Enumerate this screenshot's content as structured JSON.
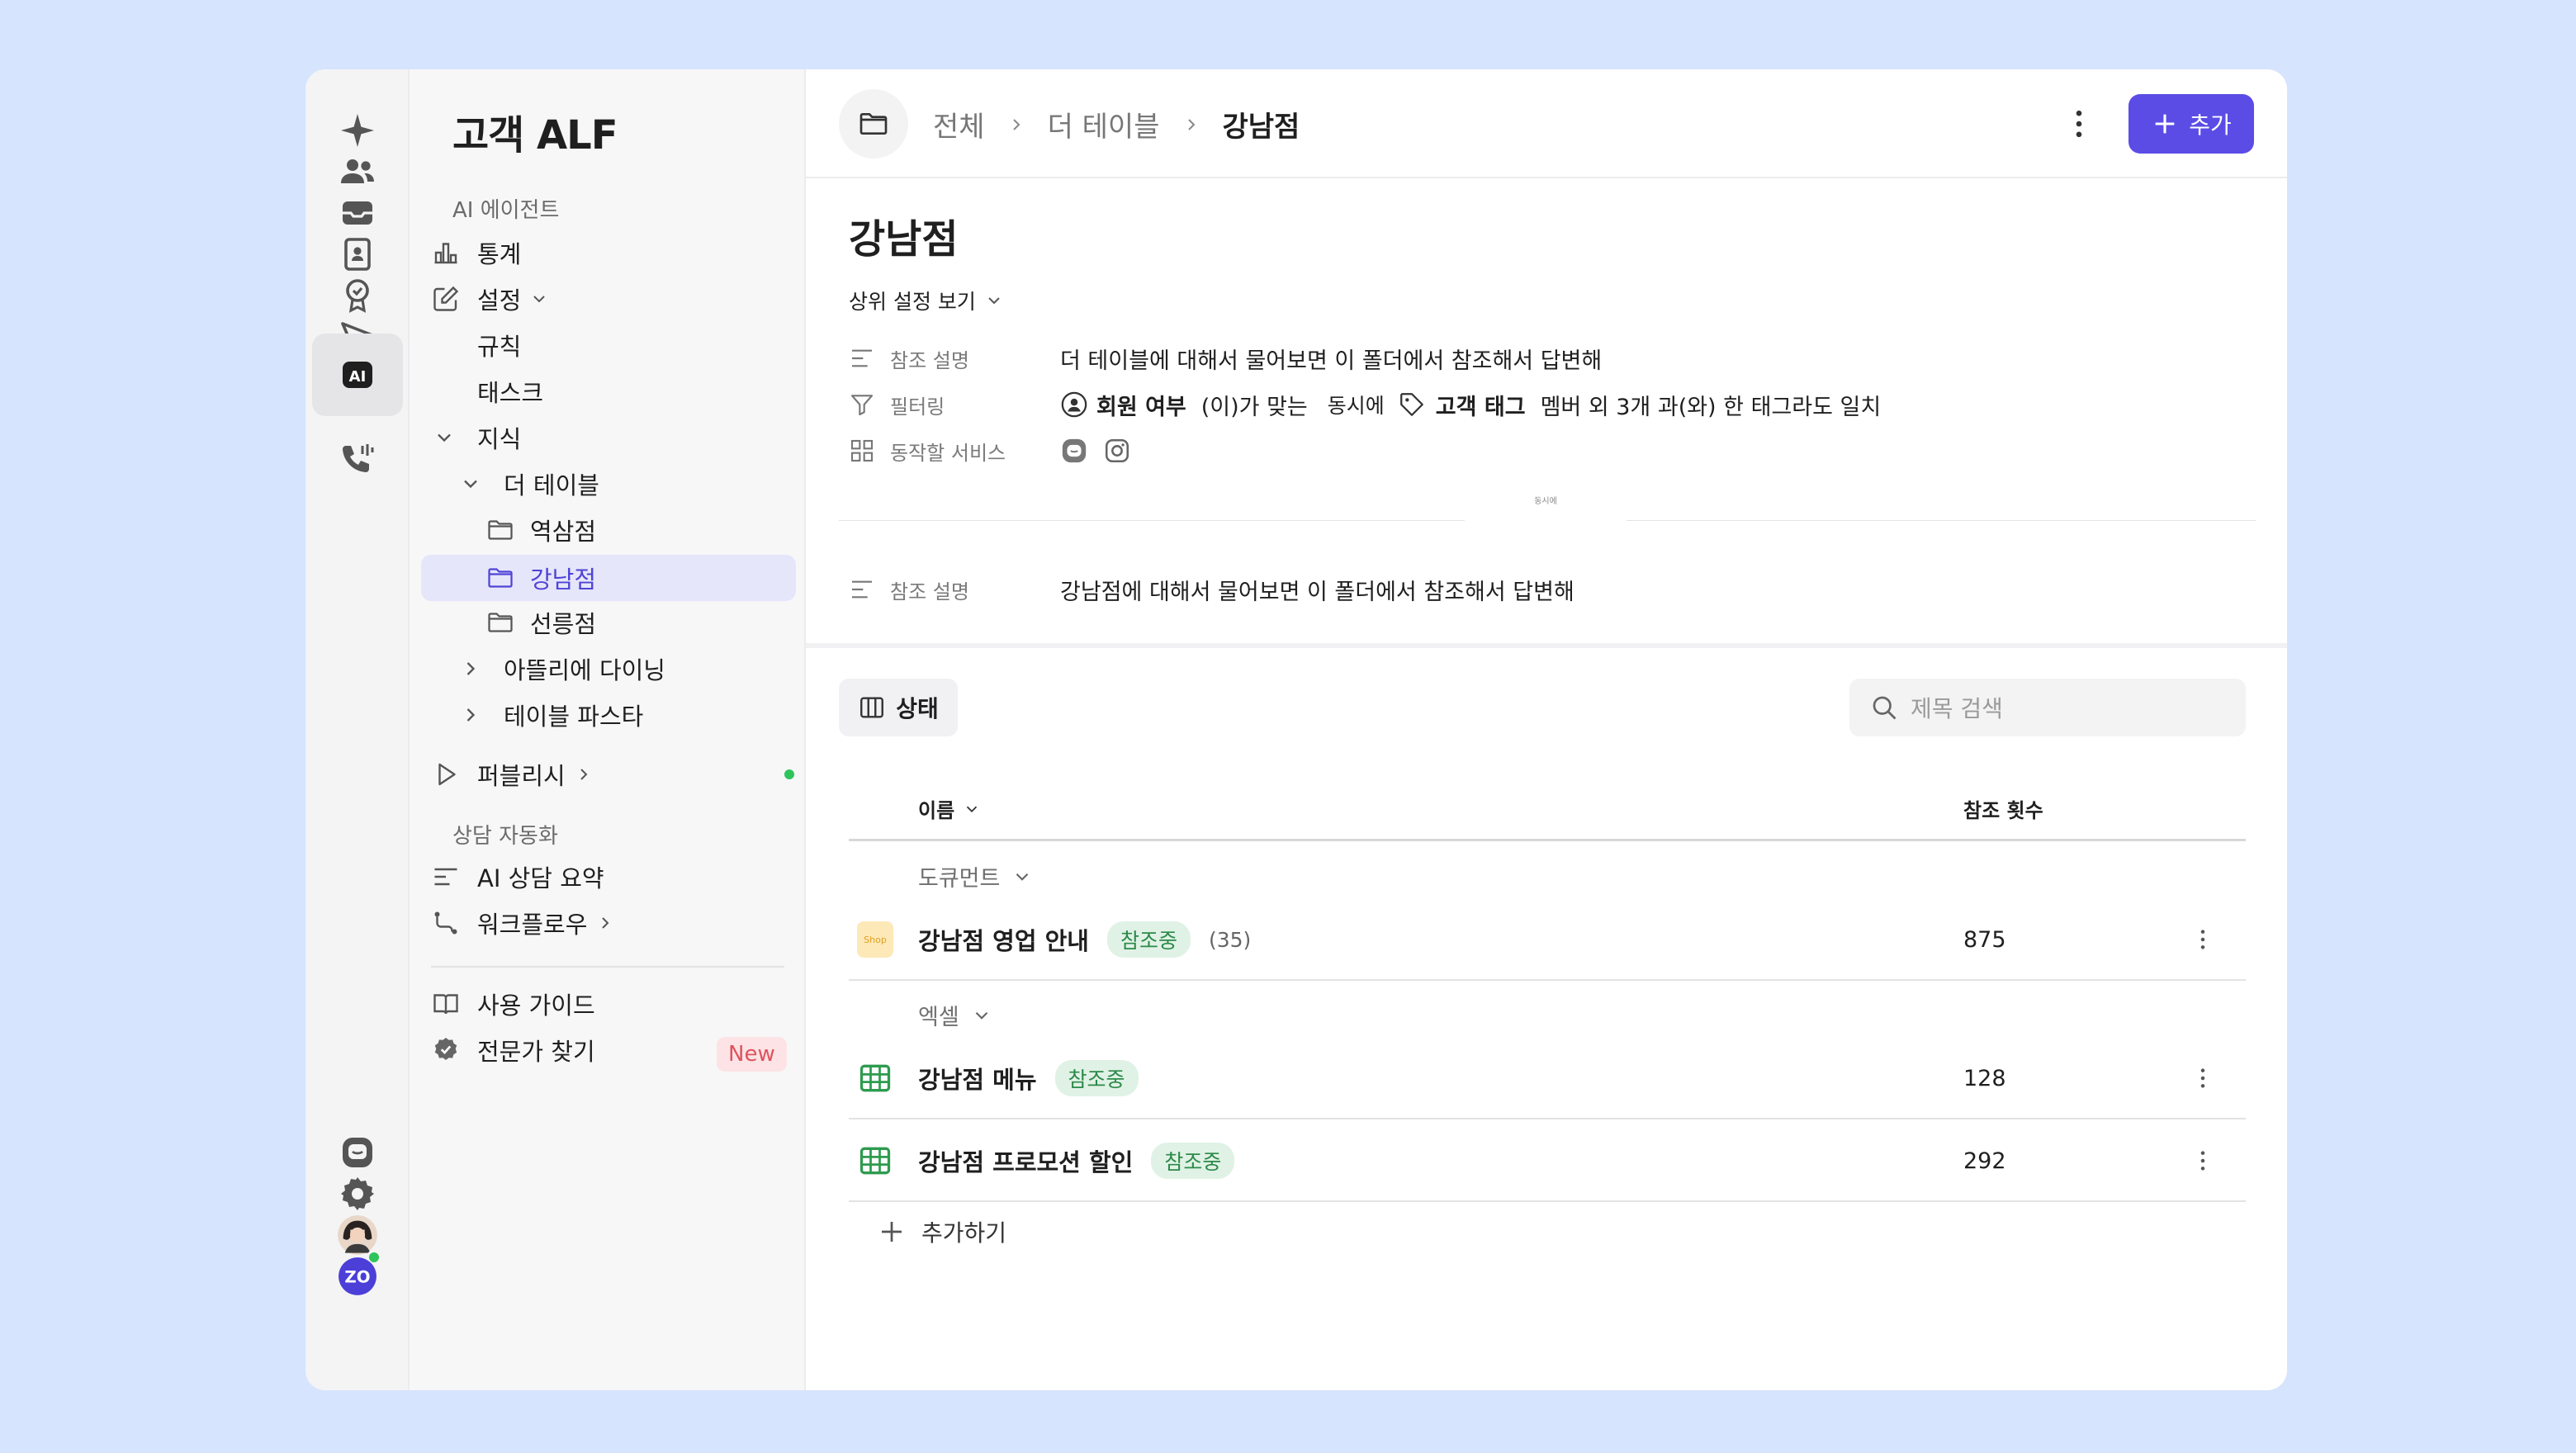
{
  "app": {
    "title": "고객 ALF"
  },
  "sidebar": {
    "section_ai": "AI 에이전트",
    "stats": "통계",
    "settings": "설정",
    "rules": "규칙",
    "tasks": "태스크",
    "knowledge": "지식",
    "folder_root": "더 테이블",
    "f1": "역삼점",
    "f2": "강남점",
    "f3": "선릉점",
    "f4": "아뜰리에 다이닝",
    "f5": "테이블 파스타",
    "publish": "퍼블리시",
    "section_auto": "상담 자동화",
    "summary": "AI 상담 요약",
    "workflow": "워크플로우",
    "guide": "사용 가이드",
    "expert": "전문가 찾기",
    "new_badge": "New"
  },
  "rail": {
    "icons": [
      "sparkle-icon",
      "users-icon",
      "inbox-icon",
      "contacts-icon",
      "badge-icon",
      "send-icon",
      "book-icon",
      "ai-icon",
      "phone-icon",
      "chat-icon",
      "settings-icon",
      "avatar",
      "zo-logo"
    ],
    "avatar_text": "ZO"
  },
  "header": {
    "crumb1": "전체",
    "crumb2": "더 테이블",
    "crumb3": "강남점",
    "add_label": "추가"
  },
  "page": {
    "title": "강남점",
    "parent_settings": "상위 설정 보기"
  },
  "parent": {
    "ref_label": "참조 설명",
    "ref_value": "더 테이블에 대해서 물어보면 이 폴더에서 참조해서 답변해",
    "filter_label": "필터링",
    "filter_member": "회원 여부",
    "filter_member_suffix": "(이)가 맞는",
    "filter_and": "동시에",
    "filter_tag": "고객 태그",
    "filter_tag_suffix": "멤버 외 3개 과(와) 한 태그라도 일치",
    "service_label": "동작할 서비스",
    "divider_text": "동시에"
  },
  "own": {
    "ref_label": "참조 설명",
    "ref_value": "강남점에 대해서 물어보면 이 폴더에서 참조해서 답변해"
  },
  "toolbar": {
    "status_label": "상태",
    "search_placeholder": "제목 검색"
  },
  "table": {
    "col_name": "이름",
    "col_count": "참조 횟수",
    "group_doc": "도큐먼트",
    "group_excel": "엑셀",
    "rows": [
      {
        "name": "강남점 영업 안내",
        "tag": "참조중",
        "extra": "(35)",
        "count": "875",
        "icon": "Shop"
      },
      {
        "name": "강남점 메뉴",
        "tag": "참조중",
        "count": "128"
      },
      {
        "name": "강남점 프로모션 할인",
        "tag": "참조중",
        "count": "292"
      }
    ],
    "add_label": "추가하기"
  },
  "colors": {
    "accent": "#5b4ce6",
    "selected_bg": "#e6e6fa",
    "tag_bg": "#e0f2e6",
    "tag_text": "#2c8a49",
    "online": "#2ec45b"
  }
}
